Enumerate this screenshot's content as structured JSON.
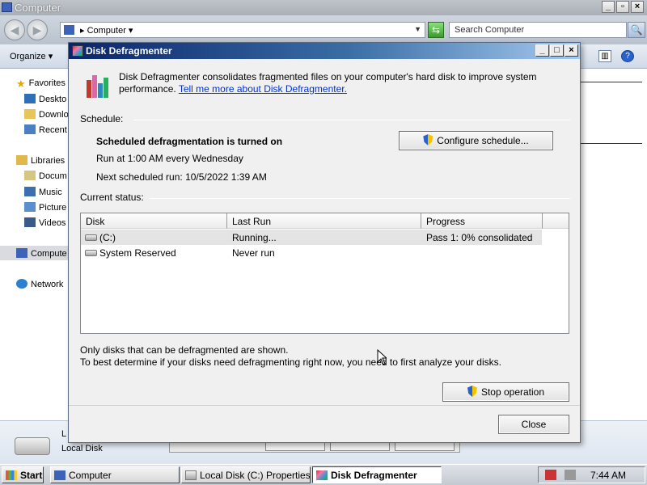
{
  "explorer": {
    "title": "Computer",
    "address": "Computer",
    "search_placeholder": "Search Computer",
    "organize_label": "Organize",
    "nav": {
      "favorites": "Favorites",
      "desktop": "Deskto",
      "downloads": "Downlo",
      "recent": "Recent",
      "libraries": "Libraries",
      "documents": "Docum",
      "music": "Music",
      "pictures": "Picture",
      "videos": "Videos",
      "computer": "Compute",
      "network": "Network"
    },
    "details": {
      "name": "L",
      "type": "Local Disk"
    }
  },
  "dialog": {
    "title": "Disk Defragmenter",
    "intro_text": "Disk Defragmenter consolidates fragmented files on your computer's hard disk to improve system performance.",
    "intro_link": "Tell me more about Disk Defragmenter.",
    "schedule_label": "Schedule:",
    "schedule_status": "Scheduled defragmentation is turned on",
    "schedule_run": "Run at 1:00 AM every Wednesday",
    "schedule_next": "Next scheduled run: 10/5/2022 1:39 AM",
    "configure_button": "Configure schedule...",
    "current_status_label": "Current status:",
    "columns": [
      "Disk",
      "Last Run",
      "Progress"
    ],
    "rows": [
      {
        "disk": "(C:)",
        "last_run": "Running...",
        "progress": "Pass 1: 0% consolidated"
      },
      {
        "disk": "System Reserved",
        "last_run": "Never run",
        "progress": ""
      }
    ],
    "footer_note1": "Only disks that can be defragmented are shown.",
    "footer_note2": "To best determine if your disks need defragmenting right now, you need to first analyze your disks.",
    "stop_button": "Stop operation",
    "close_button": "Close"
  },
  "taskbar": {
    "start_label": "Start",
    "items": [
      {
        "label": "Computer"
      },
      {
        "label": "Local Disk (C:) Properties"
      },
      {
        "label": "Disk Defragmenter"
      }
    ],
    "clock": "7:44 AM"
  },
  "colors": {
    "title_gradient_start": "#0a246a",
    "title_gradient_end": "#a6caf0",
    "link": "#0033cc",
    "selected_row": "#e4e4e4"
  }
}
